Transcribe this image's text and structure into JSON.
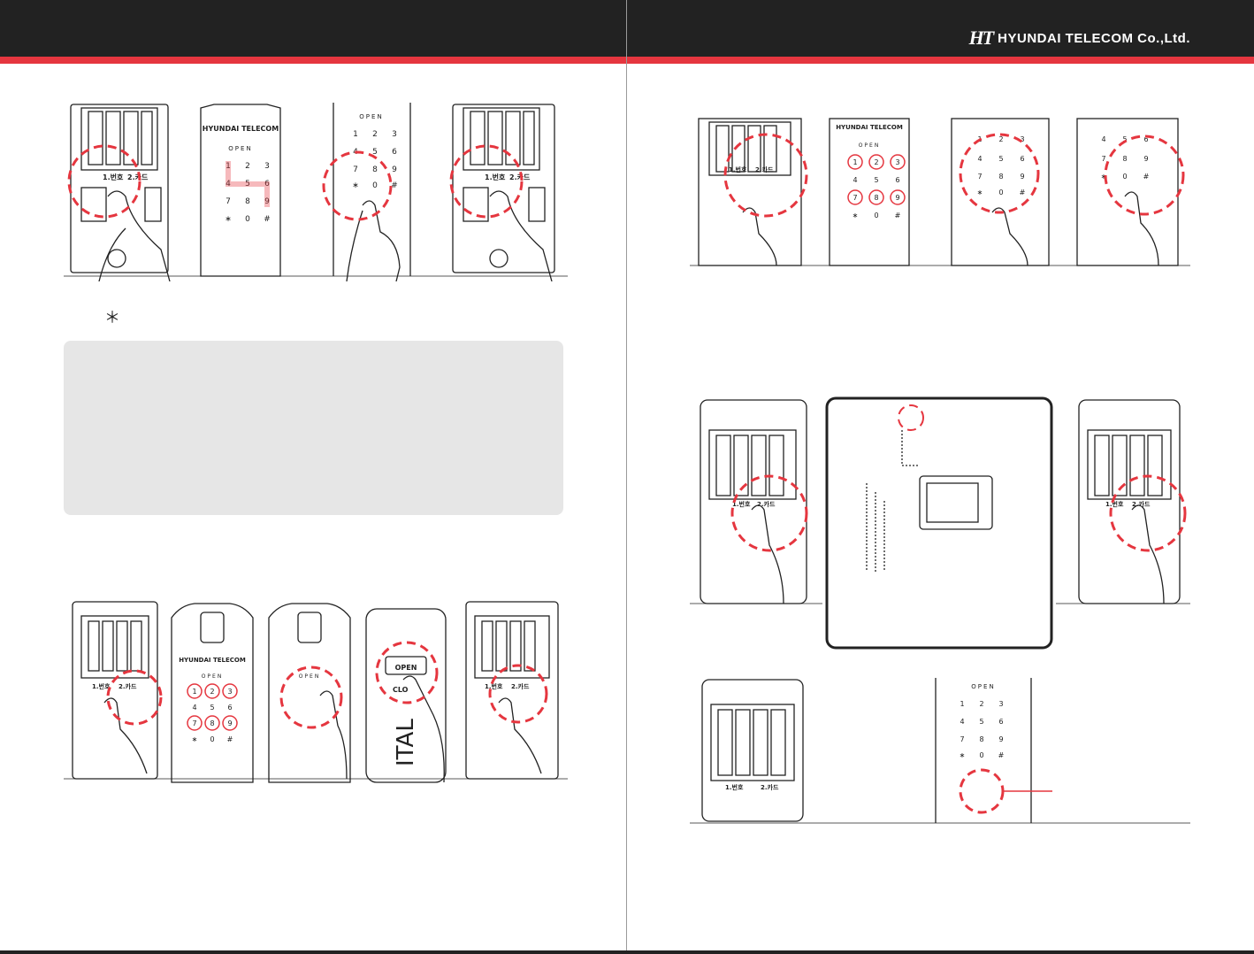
{
  "header": {
    "brand_logo": "HT",
    "brand_name": "HYUNDAI TELECOM Co.,Ltd."
  },
  "note": {
    "star": "＊"
  },
  "device": {
    "brand": "HYUNDAI TELECOM",
    "open_label": "OPEN",
    "keys": [
      "1",
      "2",
      "3",
      "4",
      "5",
      "6",
      "7",
      "8",
      "9",
      "∗",
      "0",
      "#"
    ],
    "slot1_label": "1.번호",
    "slot2_label": "2.카드",
    "open_button": "OPEN",
    "close_button_partial": "CLO",
    "side_text": "ITAL"
  },
  "colors": {
    "header_bg": "#222222",
    "accent_red": "#e5363f",
    "note_bg": "#e6e6e6"
  }
}
